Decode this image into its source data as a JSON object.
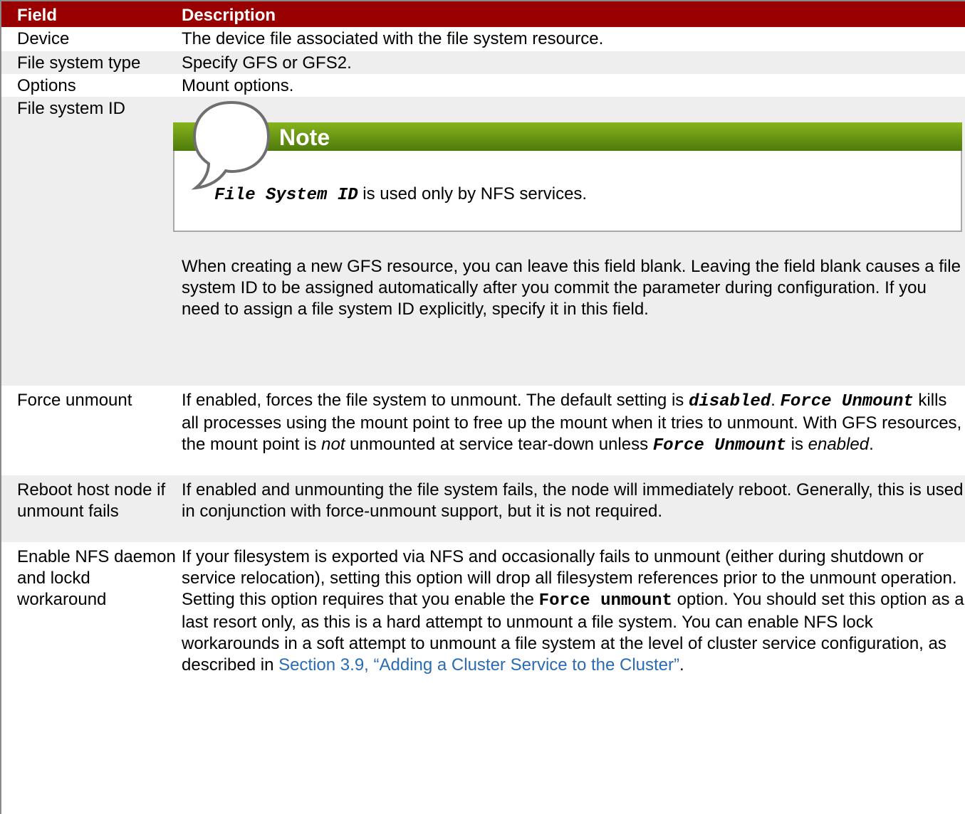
{
  "table": {
    "headers": {
      "field": "Field",
      "description": "Description"
    },
    "rows": {
      "device": {
        "field": "Device",
        "description": "The device file associated with the file system resource."
      },
      "fstype": {
        "field": "File system type",
        "description": "Specify GFS or GFS2."
      },
      "options": {
        "field": "Options",
        "description": "Mount options."
      },
      "fsid": {
        "field": "File system ID",
        "note": {
          "title": "Note",
          "term": "File System ID",
          "text": " is used only by NFS services."
        },
        "paragraph": "When creating a new GFS resource, you can leave this field blank. Leaving the field blank causes a file system ID to be assigned automatically after you commit the parameter during configuration. If you need to assign a file system ID explicitly, specify it in this field."
      },
      "force": {
        "field": "Force unmount",
        "p1": "If enabled, forces the file system to unmount. The default setting is ",
        "disabled": "disabled",
        "p2": ". ",
        "force_unmount": "Force Unmount",
        "p3": " kills all processes using the mount point to free up the mount when it tries to unmount. With GFS resources, the mount point is ",
        "not": "not",
        "p4": " unmounted at service tear-down unless ",
        "force_unmount2": "Force Unmount",
        "p5": " is ",
        "enabled": "enabled",
        "p6": "."
      },
      "reboot": {
        "field": "Reboot host node if unmount fails",
        "description": "If enabled and unmounting the file system fails, the node will immediately reboot. Generally, this is used in conjunction with force-unmount support, but it is not required."
      },
      "nfs": {
        "field": "Enable NFS daemon and lockd workaround",
        "p1": "If your filesystem is exported via NFS and occasionally fails to unmount (either during shutdown or service relocation), setting this option will drop all filesystem references prior to the unmount operation. Setting this option requires that you enable the ",
        "force_unmount": "Force unmount",
        "p2": " option. You should set this option as a last resort only, as this is a hard attempt to unmount a file system. You can enable NFS lock workarounds in a soft attempt to unmount a file system at the level of cluster service configuration, as described in ",
        "link": "Section 3.9, “Adding a Cluster Service to the Cluster”",
        "p3": "."
      }
    }
  },
  "colors": {
    "header_bg": "#990000",
    "note_bar": "#6a9a14",
    "link": "#2a6bb4",
    "row_alt": "#eeeeee"
  },
  "icons": {
    "note": "speech-bubble-icon"
  }
}
